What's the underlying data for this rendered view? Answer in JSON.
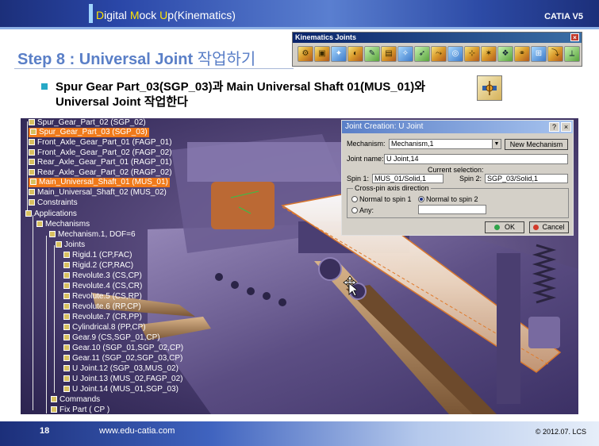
{
  "header": {
    "title_parts": [
      "D",
      "igital ",
      "M",
      "ock ",
      "U",
      "p(Kinematics)"
    ],
    "brand": "CATIA V5"
  },
  "step": {
    "prefix": "Step 8 : Universal Joint",
    "suffix": " 작업하기"
  },
  "toolbar": {
    "title": "Kinematics Joints",
    "close_label": "×",
    "icons": [
      "revolute-joint",
      "prismatic-joint",
      "cylindrical-joint",
      "screw-joint",
      "rigid-joint",
      "spherical-joint",
      "planar-joint",
      "point-curve-joint",
      "slide-curve-joint",
      "roll-curve-joint",
      "point-surface-joint",
      "universal-joint",
      "cv-joint",
      "gear-joint",
      "rack-joint",
      "cable-joint",
      "axis-system-joint"
    ]
  },
  "instruction": {
    "line1": "Spur Gear Part_03(SGP_03)과 Main Universal Shaft 01(MUS_01)와",
    "line2": "Universal Joint 작업한다"
  },
  "tree": {
    "items": [
      {
        "label": "Spur_Gear_Part_02 (SGP_02)",
        "selected": false
      },
      {
        "label": "Spur_Gear_Part_03 (SGP_03)",
        "selected": true
      },
      {
        "label": "Front_Axle_Gear_Part_01 (FAGP_01)",
        "selected": false
      },
      {
        "label": "Front_Axle_Gear_Part_02 (FAGP_02)",
        "selected": false
      },
      {
        "label": "Rear_Axle_Gear_Part_01 (RAGP_01)",
        "selected": false
      },
      {
        "label": "Rear_Axle_Gear_Part_02 (RAGP_02)",
        "selected": false
      },
      {
        "label": "Main_Universal_Shaft_01 (MUS_01)",
        "selected": true
      },
      {
        "label": "Main_Universal_Shaft_02 (MUS_02)",
        "selected": false
      },
      {
        "label": "Constraints",
        "selected": false
      },
      {
        "label": "Applications",
        "selected": false
      },
      {
        "label": "Mechanisms",
        "selected": false
      },
      {
        "label": "Mechanism.1, DOF=6",
        "selected": false
      },
      {
        "label": "Joints",
        "selected": false
      },
      {
        "label": "Rigid.1 (CP,FAC)",
        "selected": false
      },
      {
        "label": "Rigid.2 (CP,RAC)",
        "selected": false
      },
      {
        "label": "Revolute.3 (CS,CP)",
        "selected": false
      },
      {
        "label": "Revolute.4 (CS,CR)",
        "selected": false
      },
      {
        "label": "Revolute.5 (CS,RP)",
        "selected": false
      },
      {
        "label": "Revolute.6 (RP,CP)",
        "selected": false
      },
      {
        "label": "Revolute.7 (CR,PP)",
        "selected": false
      },
      {
        "label": "Cylindrical.8 (PP,CP)",
        "selected": false
      },
      {
        "label": "Gear.9 (CS,SGP_01,CP)",
        "selected": false
      },
      {
        "label": "Gear.10 (SGP_01,SGP_02,CP)",
        "selected": false
      },
      {
        "label": "Gear.11 (SGP_02,SGP_03,CP)",
        "selected": false
      },
      {
        "label": "U Joint.12 (SGP_03,MUS_02)",
        "selected": false
      },
      {
        "label": "U Joint.13 (MUS_02,FAGP_02)",
        "selected": false
      },
      {
        "label": "U Joint.14 (MUS_01,SGP_03)",
        "selected": false
      },
      {
        "label": "Commands",
        "selected": false
      },
      {
        "label": "Fix Part ( CP )",
        "selected": false
      }
    ]
  },
  "dialog": {
    "title": "Joint Creation: U Joint",
    "help_label": "?",
    "close_label": "×",
    "mechanism_label": "Mechanism:",
    "mechanism_value": "Mechanism,1",
    "new_mechanism_label": "New Mechanism",
    "joint_name_label": "Joint name:",
    "joint_name_value": "U Joint,14",
    "current_selection_label": "Current selection:",
    "spin1_label": "Spin 1:",
    "spin1_value": "MUS_01/Solid,1",
    "spin2_label": "Spin 2:",
    "spin2_value": "SGP_03/Solid,1",
    "crosspin_label": "Cross-pin axis direction",
    "normal_spin1_label": "Normal to spin 1",
    "normal_spin2_label": "Normal to spin 2",
    "any_label": "Any:",
    "ok_label": "OK",
    "cancel_label": "Cancel"
  },
  "footer": {
    "page": "18",
    "url": "www.edu-catia.com",
    "copyright": "© 2012.07. LCS"
  }
}
